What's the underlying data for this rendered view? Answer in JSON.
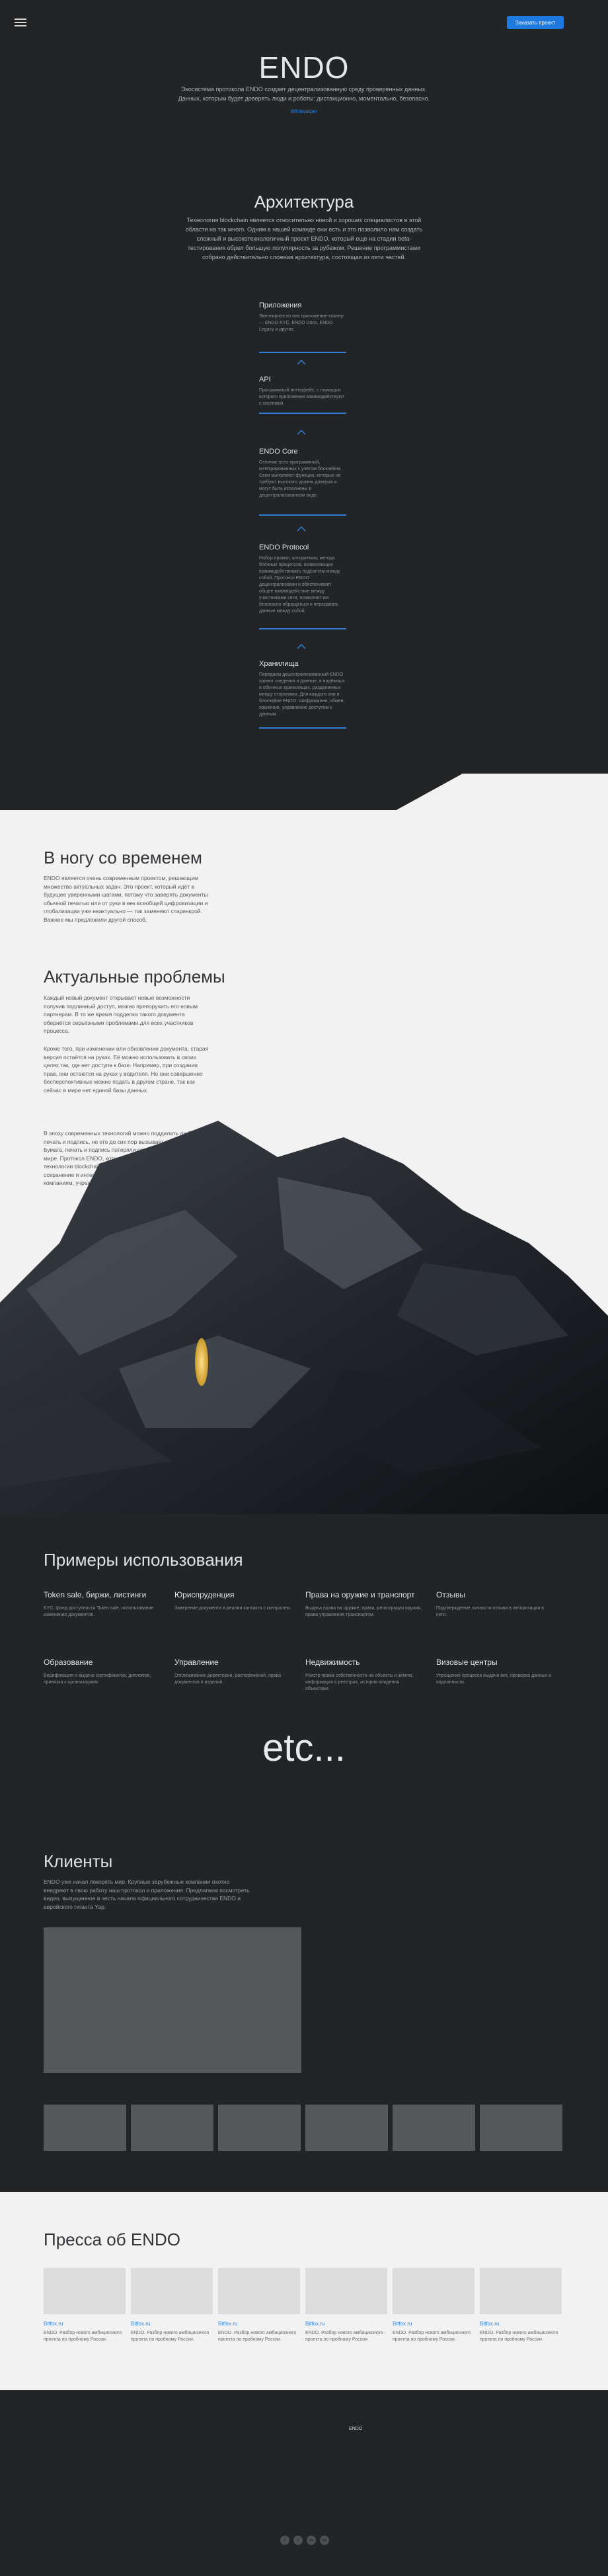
{
  "header": {
    "cta_label": "Заказать проект"
  },
  "hero": {
    "title": "ENDO",
    "subtitle": "Экосистема протокола ENDO создает децентрализованную среду проверенных данных. Данных, которым будет доверять люди и роботы: дистанционно, моментально, безопасно.",
    "link": "Whitepaper"
  },
  "architecture": {
    "title": "Архитектура",
    "subtitle": "Технология blockchain является относительно новой и хороших специалистов в этой области на так много. Одним в нашей команде они есть и это позволило нам создать сложный и высокотехнологичный проект ENDO, который еще на стадии beta-тестирования обрел большую популярность за рубежом. Решение программистами собрано действительно сложная архитектура, состоящая из пяти частей.",
    "layers": [
      {
        "title": "Приложения",
        "text": "Эвентирное из них приложение-сканер — ENDO KYC, ENDO Docs, ENDO Legacy и другие."
      },
      {
        "title": "API",
        "text": "Программный интерфейс, с помощью которого приложения взаимодействуют с системой."
      },
      {
        "title": "ENDO Core",
        "text": "Отличие всех программный, интегрированных с учётом блокчейна. Свои выполняет функции, которые не требуют высокого уровня доверия и могут быть исполнены в децентрализованном виде."
      },
      {
        "title": "ENDO Protocol",
        "text": "Набор правил, алгоритмов, метода блочных процессов, позволяющих взаимодействовать подсистем между собой. Протокол ENDO децентрализован и обеспечивает общее взаимодействие между участниками сети, позволяет им безопасно обращаться и передавать данные между собой."
      },
      {
        "title": "Хранилища",
        "text": "Передаем децентрализованный ENDO хранит сведения и данные, в надёжных и обычных хранилищах, разделенных между сторонами. Для каждого они в блокчейне ENDO. Шифрование, обмен, хранение, управление доступом к данным."
      }
    ]
  },
  "time": {
    "title": "В ногу со временем",
    "text": "ENDO является очень современным проектом, решающим множество актуальных задач. Это проект, который идёт в будущее уверенными шагами, потому что заверять документы обычной печатью или от руки в век всеобщей цифровизации и глобализации уже неактуально — так заменяют старинкрой. Важнее мы предложили другой способ."
  },
  "problems": {
    "title": "Актуальные проблемы",
    "p1": "Каждый новый документ открывает новые возможности получив подлинный доступ, можно препоручить его новым партнерам. В то же время подделка такого документа обернётся серьёзными проблемами для всех участников процесса.",
    "p2": "Кроме того, при изменении или обновлении документа, старая версия остаётся на руках. Её можно использовать в своих целях так, где нет доступа к базе. Например, при создании прав, они остаются на руках у водителя. Но они совершенно бесперспективные можно подать в другом стране, так как сейчас в мире нет единой базы данных.",
    "p3": "В эпоху современных технологий можно подделать любую печать и подпись, но это до сих пор вызывает доверие. Бумага, печать и подпись потеряли своё значение в цифровом мире. Протокол ENDO, который использует встраивания технологии blockchain, автоматически обеспечивает сохранение и интеграцию с документами, помогая управлять компаниям, учреждениям и отдельным лицам."
  },
  "usecases": {
    "title": "Примеры использования",
    "items": [
      {
        "title": "Token sale, биржи, листинги",
        "text": "KYC, фонд доступности Token sale, использование изменения документов."
      },
      {
        "title": "Юриспруденция",
        "text": "Заверение документа в реалии контакта с контролем."
      },
      {
        "title": "Права на оружие и транспорт",
        "text": "Выдача права на оружие, права, регистрация оружия, права управления транспортом."
      },
      {
        "title": "Отзывы",
        "text": "Подтверждение личности отзыва в авторизации в сети."
      },
      {
        "title": "Образование",
        "text": "Верификация и выдача сертификатов, дипломов, привязка к организациям."
      },
      {
        "title": "Управление",
        "text": "Отслеживание директории, распоряжений, права документов и изделий."
      },
      {
        "title": "Недвижимость",
        "text": "Реестр права собственности на объекты и землю, информация о реестрах, история владения объектами."
      },
      {
        "title": "Визовые центры",
        "text": "Упрощение процесса выдачи виз, проверка данных и подлинности."
      }
    ],
    "etc": "etc..."
  },
  "clients": {
    "title": "Клиенты",
    "text": "ENDO уже начал покорять мир. Крупные зарубежные компании охотно внедряют в свою работу наш протокол и приложения. Предлагаем посмотреть видео, выпущенное в честь начала официального сотрудничества ENDO и евройского гиганта Yap."
  },
  "press": {
    "title": "Пресса об ENDO",
    "items": [
      {
        "source": "Bitfox.ru",
        "text": "ENDO. Разбор нового амбициозного проекта по пробному России."
      },
      {
        "source": "Bitfox.ru",
        "text": "ENDO. Разбор нового амбициозного проекта по пробному России."
      },
      {
        "source": "Bitfox.ru",
        "text": "ENDO. Разбор нового амбициозного проекта по пробному России."
      },
      {
        "source": "Bitfox.ru",
        "text": "ENDO. Разбор нового амбициозного проекта по пробному России."
      },
      {
        "source": "Bitfox.ru",
        "text": "ENDO. Разбор нового амбициозного проекта по пробному России."
      },
      {
        "source": "Bitfox.ru",
        "text": "ENDO. Разбор нового амбициозного проекта по пробному России."
      }
    ]
  },
  "footer": {
    "columns": [
      [
        "",
        "",
        "",
        "",
        "",
        ""
      ],
      [
        "",
        "",
        "",
        "",
        ""
      ],
      [
        "",
        "",
        "",
        ""
      ],
      [
        "ENDO",
        "",
        ""
      ],
      [
        "",
        "",
        "",
        ""
      ]
    ],
    "social": [
      "f",
      "t",
      "in",
      "vk"
    ]
  }
}
